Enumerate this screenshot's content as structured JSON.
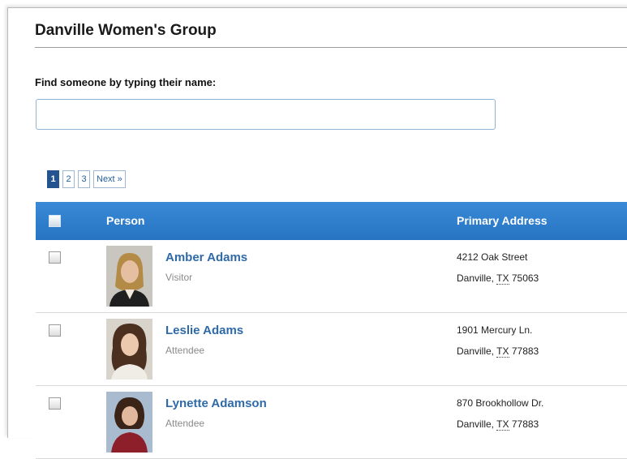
{
  "group": {
    "title": "Danville Women's Group"
  },
  "search": {
    "label": "Find someone by typing their name:",
    "value": "",
    "placeholder": ""
  },
  "pager": {
    "pages": [
      "1",
      "2",
      "3"
    ],
    "next_label": "Next »",
    "current": "1"
  },
  "table": {
    "columns": {
      "person": "Person",
      "address": "Primary Address"
    },
    "rows": [
      {
        "name": "Amber Adams",
        "role": "Visitor",
        "street": "4212 Oak Street",
        "city": "Danville,",
        "state": "TX",
        "zip": "75063"
      },
      {
        "name": "Leslie Adams",
        "role": "Attendee",
        "street": "1901 Mercury Ln.",
        "city": "Danville,",
        "state": "TX",
        "zip": "77883"
      },
      {
        "name": "Lynette Adamson",
        "role": "Attendee",
        "street": "870 Brookhollow Dr.",
        "city": "Danville,",
        "state": "TX",
        "zip": "77883"
      }
    ]
  },
  "colors": {
    "header_blue": "#2f7ccb",
    "link_blue": "#2f6aa8",
    "pager_current": "#23548f"
  },
  "icons": {
    "avatar": "person-photo"
  }
}
